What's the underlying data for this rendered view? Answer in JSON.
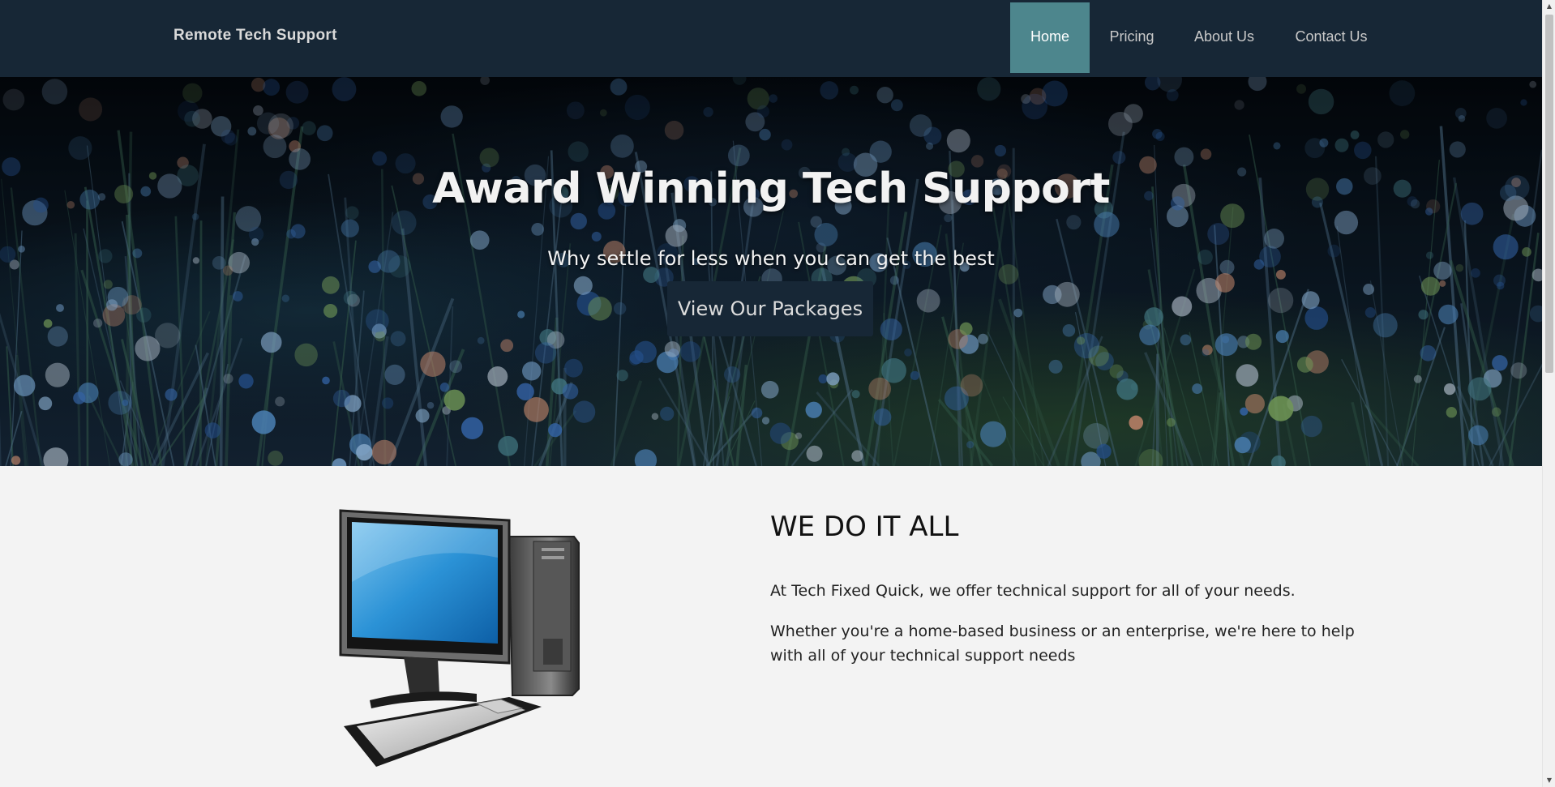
{
  "nav": {
    "brand": "Remote Tech Support",
    "items": [
      {
        "label": "Home",
        "active": true
      },
      {
        "label": "Pricing",
        "active": false
      },
      {
        "label": "About Us",
        "active": false
      },
      {
        "label": "Contact Us",
        "active": false
      }
    ]
  },
  "hero": {
    "title": "Award Winning Tech Support",
    "subtitle": "Why settle for less when you can get the best",
    "button_label": "View Our Packages"
  },
  "intro": {
    "heading": "WE DO IT ALL",
    "paragraphs": [
      "At Tech Fixed Quick, we offer technical support for all of your needs.",
      "Whether you're a home-based business or an enterprise, we're here to help with all of your technical support needs"
    ]
  },
  "colors": {
    "navbar_bg": "#172736",
    "active_nav": "#4d868d",
    "page_bg": "#f3f3f3"
  },
  "icons": {
    "hero_image": "fiber-optic-background",
    "computer_image": "desktop-computer-icon"
  }
}
